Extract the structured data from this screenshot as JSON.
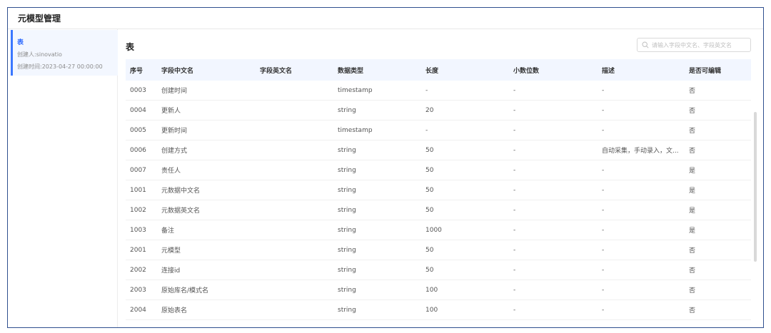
{
  "header": {
    "title": "元模型管理"
  },
  "sidebar": {
    "items": [
      {
        "name": "表",
        "creator": "创建人:sinovatio",
        "created": "创建时间:2023-04-27 00:00:00"
      }
    ]
  },
  "main": {
    "title": "表",
    "search": {
      "placeholder": "请输入字段中文名、字段英文名",
      "value": ""
    },
    "table": {
      "columns": [
        "序号",
        "字段中文名",
        "字段英文名",
        "数据类型",
        "长度",
        "小数位数",
        "描述",
        "是否可编辑"
      ],
      "rows": [
        [
          "0003",
          "创建时间",
          "",
          "timestamp",
          "-",
          "-",
          "-",
          "否"
        ],
        [
          "0004",
          "更新人",
          "",
          "string",
          "20",
          "-",
          "-",
          "否"
        ],
        [
          "0005",
          "更新时间",
          "",
          "timestamp",
          "-",
          "-",
          "-",
          "否"
        ],
        [
          "0006",
          "创建方式",
          "",
          "string",
          "50",
          "-",
          "自动采集，手动录入，文...",
          "否"
        ],
        [
          "0007",
          "责任人",
          "",
          "string",
          "50",
          "-",
          "-",
          "是"
        ],
        [
          "1001",
          "元数据中文名",
          "",
          "string",
          "50",
          "-",
          "-",
          "是"
        ],
        [
          "1002",
          "元数据英文名",
          "",
          "string",
          "50",
          "-",
          "-",
          "是"
        ],
        [
          "1003",
          "备注",
          "",
          "string",
          "1000",
          "-",
          "-",
          "是"
        ],
        [
          "2001",
          "元模型",
          "",
          "string",
          "50",
          "-",
          "-",
          "否"
        ],
        [
          "2002",
          "连接id",
          "",
          "string",
          "50",
          "-",
          "-",
          "否"
        ],
        [
          "2003",
          "原始库名/模式名",
          "",
          "string",
          "100",
          "-",
          "-",
          "否"
        ],
        [
          "2004",
          "原始表名",
          "",
          "string",
          "100",
          "-",
          "-",
          "否"
        ]
      ]
    }
  }
}
